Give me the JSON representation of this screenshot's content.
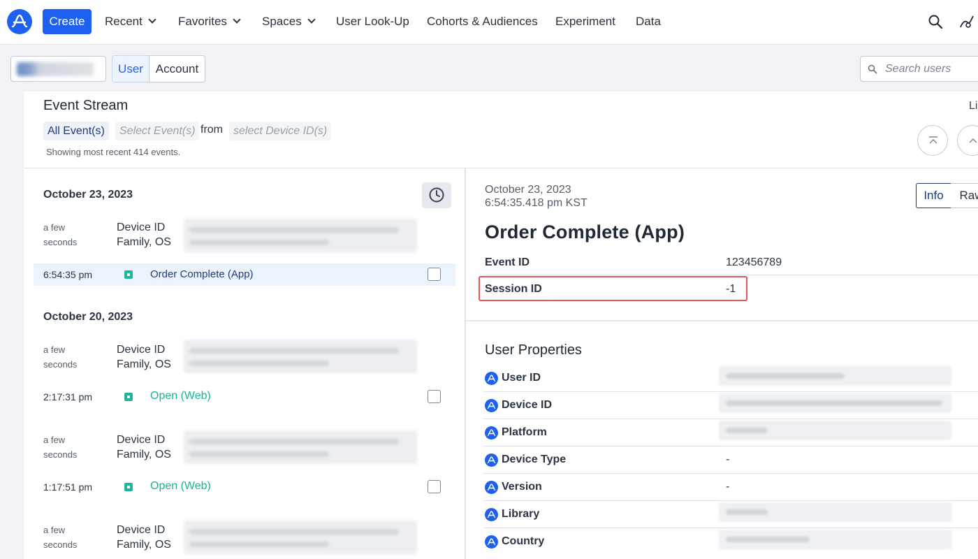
{
  "nav": {
    "create_label": "Create",
    "items": [
      {
        "label": "Recent",
        "dropdown": true
      },
      {
        "label": "Favorites",
        "dropdown": true
      },
      {
        "label": "Spaces",
        "dropdown": true
      },
      {
        "label": "User Look-Up",
        "dropdown": false
      },
      {
        "label": "Cohorts & Audiences",
        "dropdown": false
      },
      {
        "label": "Experiment",
        "dropdown": false
      },
      {
        "label": "Data",
        "dropdown": false
      }
    ],
    "icons": [
      "search-icon",
      "user-settings-icon"
    ]
  },
  "toolbar": {
    "segment": [
      "User",
      "Account"
    ],
    "selected_segment": "User",
    "search_placeholder": "Search users"
  },
  "stream": {
    "title": "Event Stream",
    "live_label_partial": "Li",
    "filter_all": "All Event(s)",
    "filter_select_placeholder": "Select Event(s)",
    "from_label": "from",
    "device_placeholder": "select Device ID(s)",
    "showing_text": "Showing most recent 414 events."
  },
  "groups": [
    {
      "date": "October 23, 2023",
      "entries": [
        {
          "ago": [
            "a few",
            "seconds"
          ],
          "device_label": [
            "Device ID",
            "Family, OS"
          ],
          "time": "6:54:35 pm",
          "event": "Order Complete (App)",
          "active": true
        }
      ]
    },
    {
      "date": "October 20, 2023",
      "entries": [
        {
          "ago": [
            "a few",
            "seconds"
          ],
          "device_label": [
            "Device ID",
            "Family, OS"
          ],
          "time": "2:17:31 pm",
          "event": "Open (Web)",
          "active": false
        },
        {
          "ago": [
            "a few",
            "seconds"
          ],
          "device_label": [
            "Device ID",
            "Family, OS"
          ],
          "time": "1:17:51 pm",
          "event": "Open (Web)",
          "active": false
        },
        {
          "ago": [
            "a few",
            "seconds"
          ],
          "device_label": [
            "Device ID",
            "Family, OS"
          ]
        }
      ]
    }
  ],
  "detail": {
    "date": "October 23, 2023",
    "time": "6:54:35.418 pm KST",
    "tabs": [
      "Info",
      "Raw"
    ],
    "selected_tab": "Info",
    "title": "Order Complete (App)",
    "fields": [
      {
        "label": "Event ID",
        "value": "123456789"
      },
      {
        "label": "Session ID",
        "value": "-1",
        "highlighted": true
      }
    ],
    "user_properties_title": "User Properties",
    "user_properties": [
      {
        "label": "User ID",
        "value": null
      },
      {
        "label": "Device ID",
        "value": null
      },
      {
        "label": "Platform",
        "value": null
      },
      {
        "label": "Device Type",
        "value": "-"
      },
      {
        "label": "Version",
        "value": "-"
      },
      {
        "label": "Library",
        "value": null
      },
      {
        "label": "Country",
        "value": null
      }
    ]
  },
  "colors": {
    "brand": "#1e61f0",
    "event_green": "#1ab394",
    "highlight_red": "#e05757",
    "active_row": "#edf3fd"
  }
}
